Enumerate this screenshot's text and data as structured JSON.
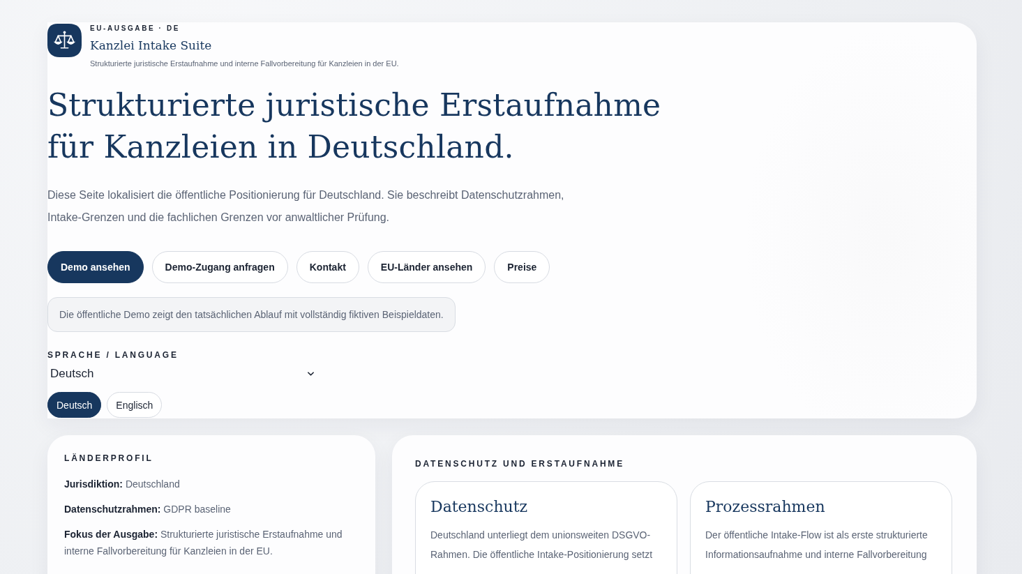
{
  "header": {
    "edition": "EU-AUSGABE · DE",
    "brand": "Kanzlei Intake Suite",
    "tagline": "Strukturierte juristische Erstaufnahme und interne Fallvorbereitung für Kanzleien in der EU."
  },
  "hero": {
    "title": "Strukturierte juristische Erstaufnahme für Kanzleien in Deutschland.",
    "intro": "Diese Seite lokalisiert die öffentliche Positionierung für Deutschland. Sie beschreibt Datenschutzrahmen, Intake-Grenzen und die fachlichen Grenzen vor anwaltlicher Prüfung.",
    "actions": [
      {
        "label": "Demo ansehen",
        "kind": "primary"
      },
      {
        "label": "Demo-Zugang anfragen",
        "kind": "secondary"
      },
      {
        "label": "Kontakt",
        "kind": "secondary"
      },
      {
        "label": "EU-Länder ansehen",
        "kind": "secondary"
      },
      {
        "label": "Preise",
        "kind": "secondary"
      }
    ],
    "demo_note": "Die öffentliche Demo zeigt den tatsächlichen Ablauf mit vollständig fiktiven Beispieldaten."
  },
  "language": {
    "label": "SPRACHE / LANGUAGE",
    "value": "Deutsch",
    "options": [
      {
        "label": "Deutsch",
        "selected": true
      },
      {
        "label": "Englisch",
        "selected": false
      }
    ]
  },
  "country_profile": {
    "heading": "LÄNDERPROFIL",
    "facts": [
      "**Jurisdiktion:** Deutschland",
      "**Datenschutzrahmen:** GDPR baseline",
      "**Fokus der Ausgabe:** Strukturierte juristische Erstaufnahme und interne Fallvorbereitung für Kanzleien in der EU."
    ]
  },
  "privacy": {
    "heading": "DATENSCHUTZ UND ERSTAUFNAHME",
    "cards": [
      {
        "title": "Datenschutz",
        "text": "Deutschland unterliegt dem unionsweiten DSGVO-Rahmen. Die öffentliche Intake-Positionierung setzt"
      },
      {
        "title": "Prozessrahmen",
        "text": "Der öffentliche Intake-Flow ist als erste strukturierte Informationsaufnahme und interne Fallvorbereitung"
      }
    ]
  }
}
